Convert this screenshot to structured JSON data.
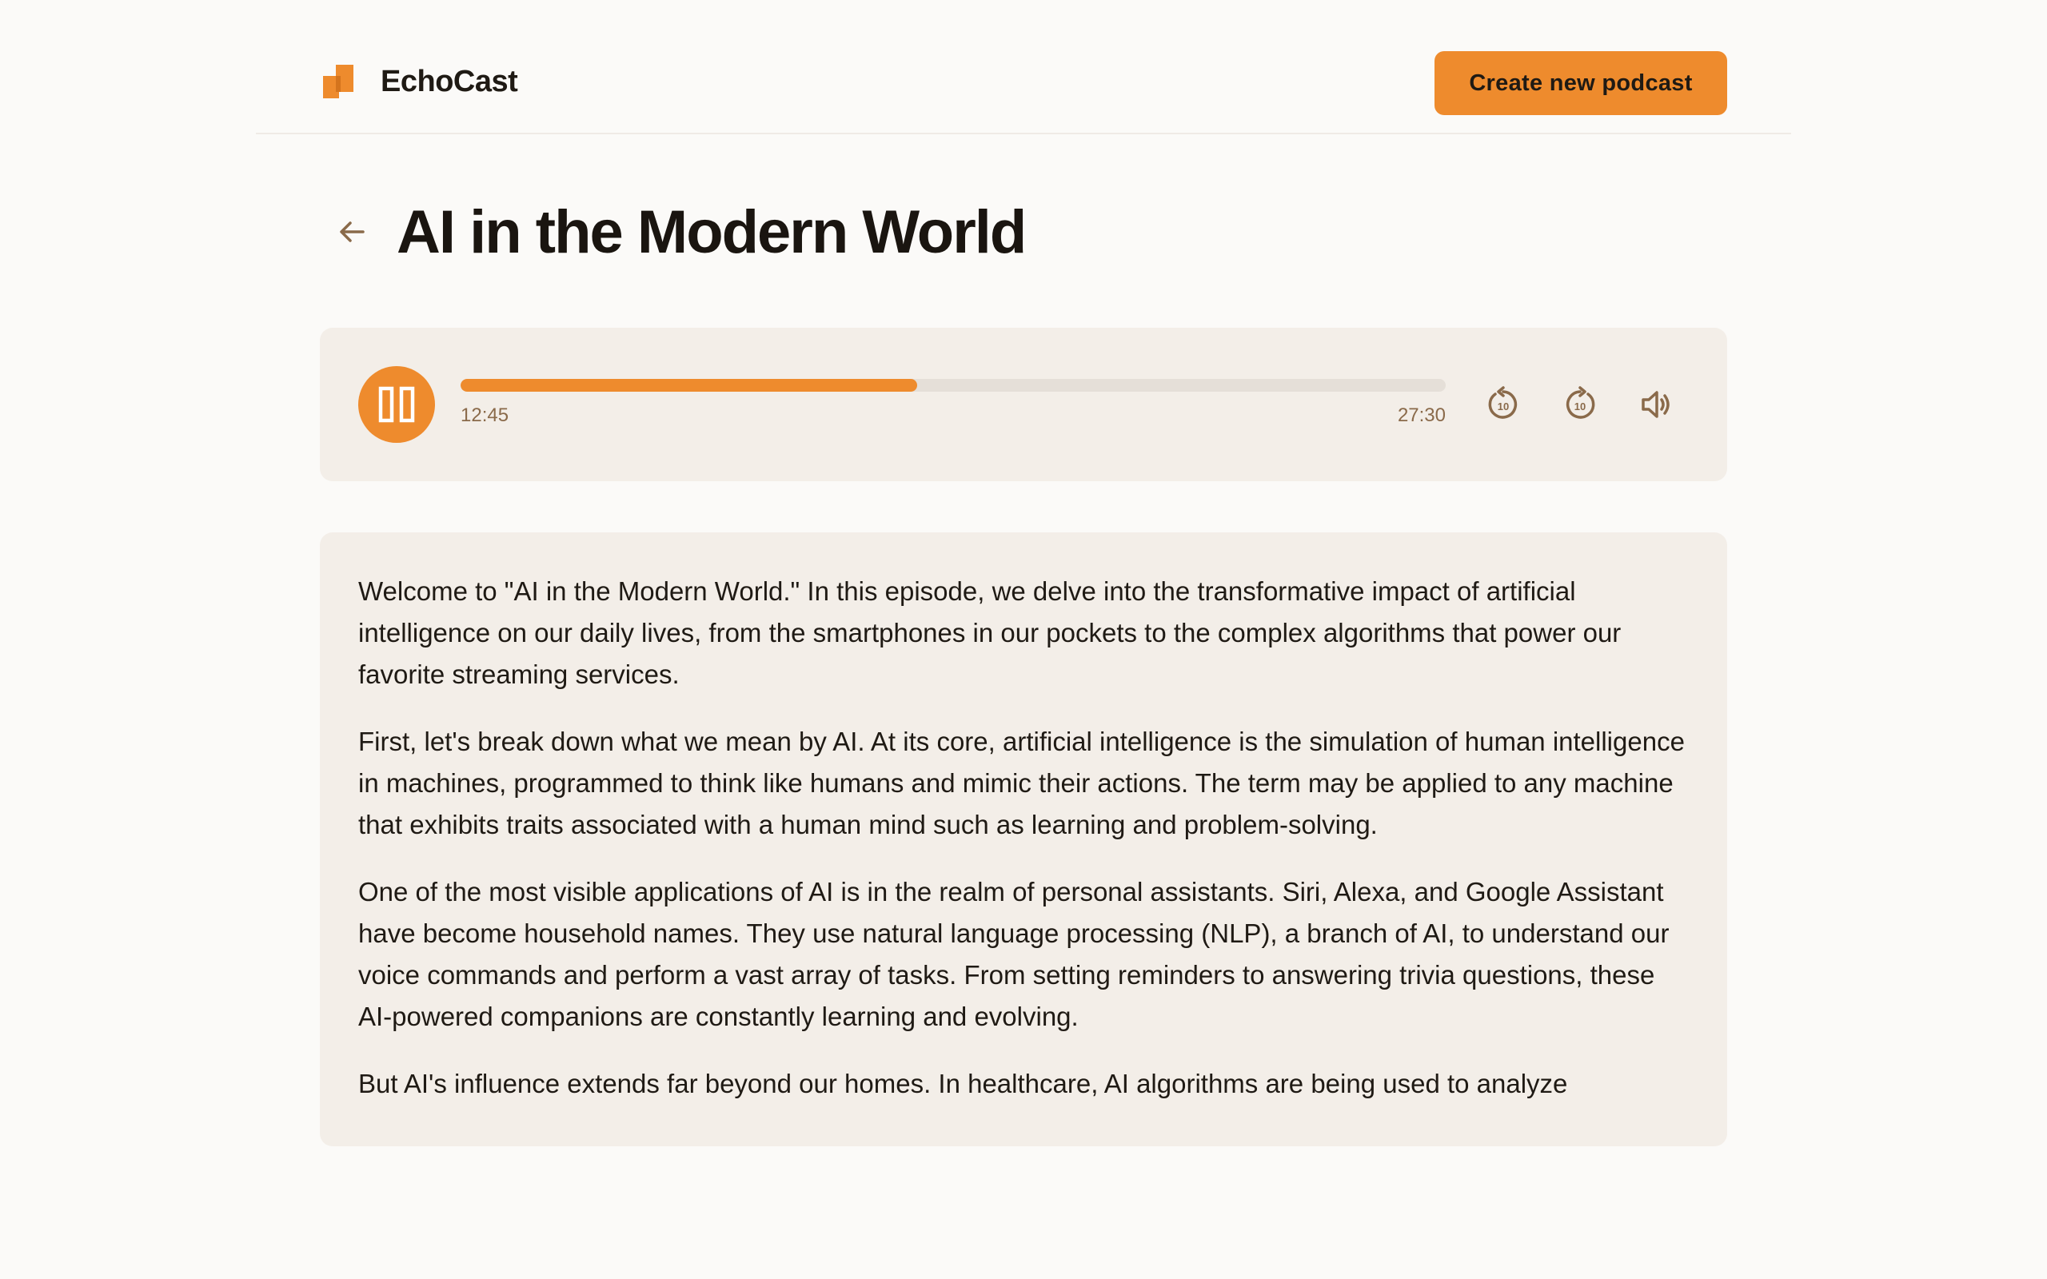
{
  "header": {
    "brand_name": "EchoCast",
    "create_button_label": "Create new podcast"
  },
  "page": {
    "title": "AI in the Modern World"
  },
  "player": {
    "state": "playing",
    "current_time": "12:45",
    "total_time": "27:30",
    "progress_fraction": 0.4636
  },
  "transcript": {
    "paragraphs": [
      "Welcome to \"AI in the Modern World.\" In this episode, we delve into the transformative impact of artificial intelligence on our daily lives, from the smartphones in our pockets to the complex algorithms that power our favorite streaming services.",
      "First, let's break down what we mean by AI. At its core, artificial intelligence is the simulation of human intelligence in machines, programmed to think like humans and mimic their actions. The term may be applied to any machine that exhibits traits associated with a human mind such as learning and problem-solving.",
      "One of the most visible applications of AI is in the realm of personal assistants. Siri, Alexa, and Google Assistant have become household names. They use natural language processing (NLP), a branch of AI, to understand our voice commands and perform a vast array of tasks. From setting reminders to answering trivia questions, these AI-powered companions are constantly learning and evolving.",
      "But AI's influence extends far beyond our homes. In healthcare, AI algorithms are being used to analyze"
    ]
  },
  "colors": {
    "accent": "#ee8b2d",
    "background": "#fbfaf8",
    "panel": "#f3eee8",
    "muted_text": "#8a6a4a",
    "track": "#e5dfd8"
  },
  "icons": {
    "logo": "echocast-logo-icon",
    "back": "arrow-left-icon",
    "play_pause": "pause-icon",
    "rewind": "rewind-10-icon",
    "forward": "forward-10-icon",
    "volume": "volume-icon"
  }
}
